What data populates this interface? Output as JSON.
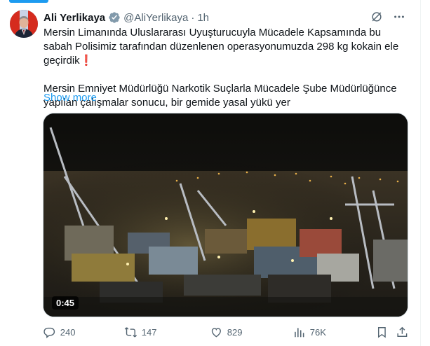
{
  "author": {
    "name": "Ali Yerlikaya",
    "handle": "@AliYerlikaya",
    "separator": "·",
    "time": "1h",
    "verified": true
  },
  "tweet": {
    "line1": "Mersin Limanında Uluslararası Uyuşturucuyla Mücadele Kapsamında bu sabah Polisimiz tarafından düzenlenen operasyonumuzda 298 kg kokain ele geçirdik",
    "line1_emoji": "❗",
    "line2": "Mersin Emniyet Müdürlüğü Narkotik Suçlarla Mücadele Şube Müdürlüğünce yapılan çalışmalar sonucu, bir gemide yasal yükü yer",
    "show_more": "Show more"
  },
  "media": {
    "type": "video",
    "duration": "0:45",
    "description_icon": "video-thumbnail-port-night"
  },
  "actions": {
    "replies": "240",
    "reposts": "147",
    "likes": "829",
    "views": "76K"
  },
  "colors": {
    "accent": "#1d9bf0",
    "text_primary": "#0f1419",
    "text_secondary": "#536471",
    "exclamation": "#d4172a"
  },
  "icons": [
    "grok-icon",
    "more-icon",
    "verified-badge-icon",
    "reply-icon",
    "repost-icon",
    "like-icon",
    "views-icon",
    "bookmark-icon",
    "share-icon"
  ]
}
